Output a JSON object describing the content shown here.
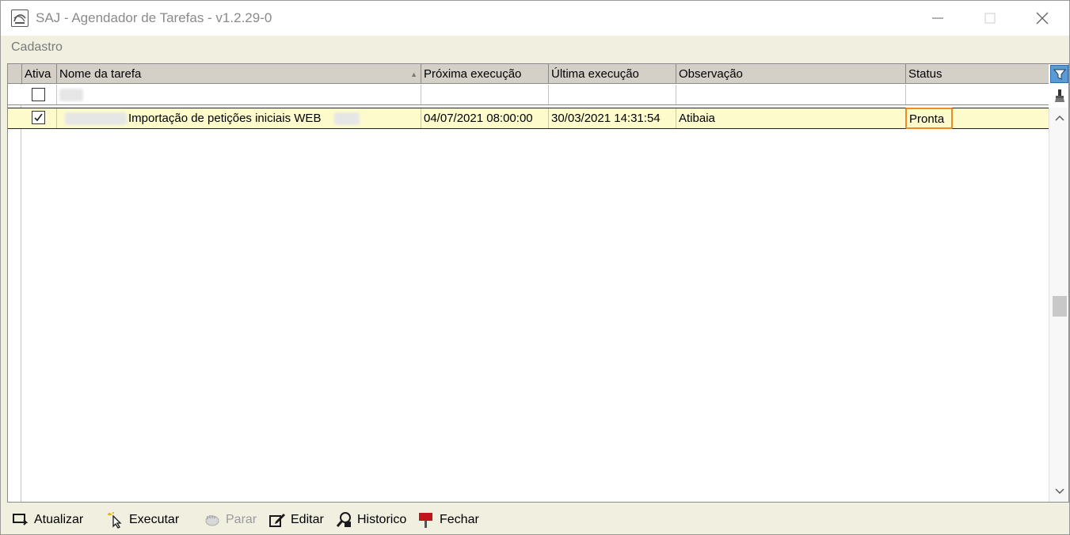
{
  "window": {
    "title": "SAJ - Agendador de Tarefas - v1.2.29-0",
    "min_glyph": "—",
    "max_glyph": "☐",
    "close_glyph": "✕"
  },
  "menu": {
    "items": [
      {
        "label": "Cadastro"
      }
    ]
  },
  "grid": {
    "columns": [
      {
        "label": "Ativa"
      },
      {
        "label": "Nome da tarefa",
        "sort": "▲"
      },
      {
        "label": "Próxima execução"
      },
      {
        "label": "Última execução"
      },
      {
        "label": "Observação"
      },
      {
        "label": "Status"
      }
    ],
    "rows": [
      {
        "ativa": true,
        "nome": "Importação de petições iniciais WEB",
        "proxima": "04/07/2021 08:00:00",
        "ultima": "30/03/2021 14:31:54",
        "observacao": "Atibaia",
        "status": "Pronta"
      }
    ],
    "filter_icon": "filter-icon",
    "clear_icon": "brush-icon",
    "scroll_up": "⌃",
    "scroll_down": "⌄"
  },
  "toolbar": {
    "atualizar": "Atualizar",
    "executar": "Executar",
    "parar": "Parar",
    "editar": "Editar",
    "historico": "Historico",
    "fechar": "Fechar"
  },
  "colors": {
    "header_bg": "#d4d0c8",
    "selected_row_bg": "#fdfbcc",
    "status_highlight": "#f08a24",
    "filter_button": "#5b9bd5"
  }
}
